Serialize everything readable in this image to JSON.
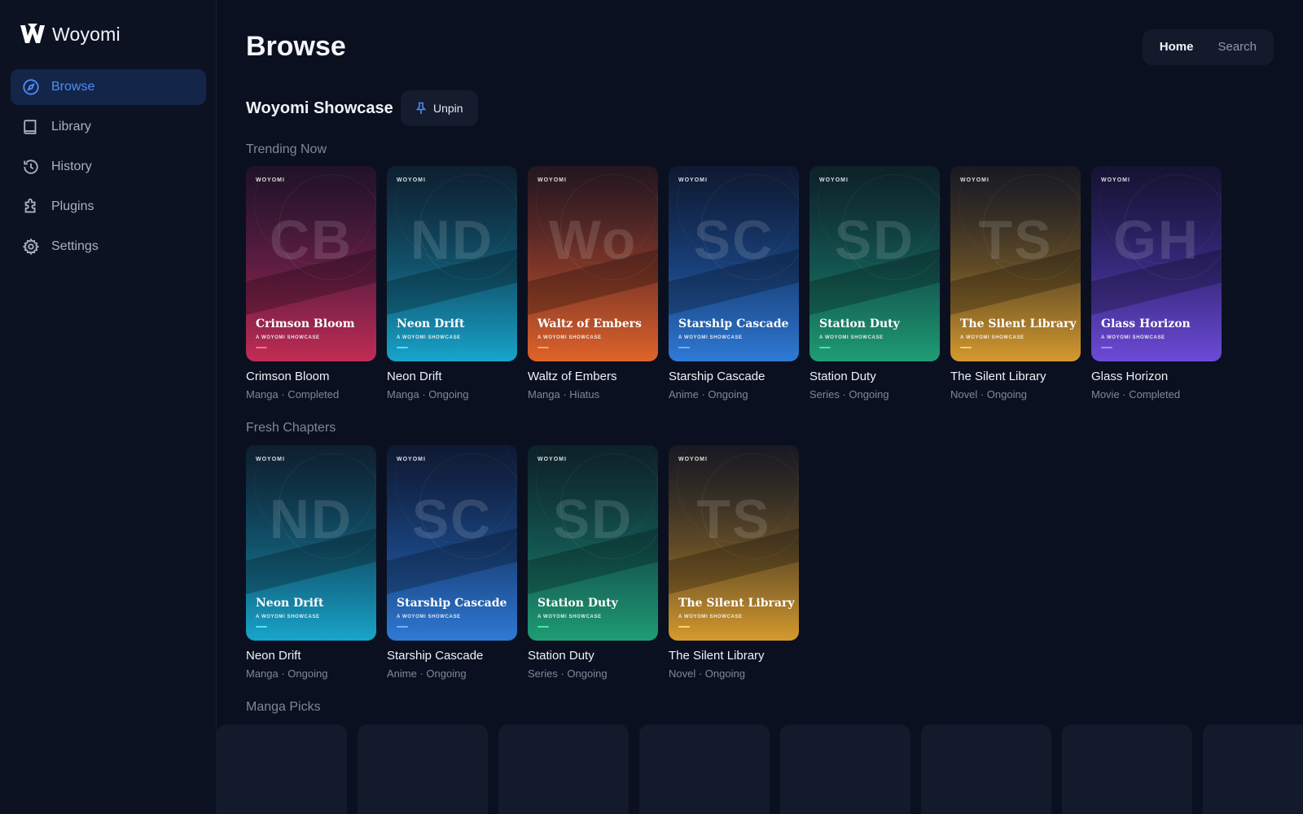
{
  "app": {
    "name": "Woyomi"
  },
  "sidebar": {
    "items": [
      {
        "label": "Browse",
        "icon": "compass-icon",
        "active": true
      },
      {
        "label": "Library",
        "icon": "book-icon"
      },
      {
        "label": "History",
        "icon": "history-icon"
      },
      {
        "label": "Plugins",
        "icon": "puzzle-icon"
      },
      {
        "label": "Settings",
        "icon": "gear-icon"
      }
    ]
  },
  "header": {
    "title": "Browse",
    "tabs": [
      {
        "label": "Home",
        "active": true
      },
      {
        "label": "Search"
      }
    ]
  },
  "showcase": {
    "title": "Woyomi Showcase",
    "unpin_label": "Unpin"
  },
  "cover_brand": "WOYOMI",
  "cover_subtitle": "A WOYOMI SHOWCASE",
  "sections": [
    {
      "label": "Trending Now",
      "items": [
        {
          "title": "Crimson Bloom",
          "meta": "Manga · Completed",
          "mono": "CB",
          "theme": "crimson",
          "accent": "#ff6f91"
        },
        {
          "title": "Neon Drift",
          "meta": "Manga · Ongoing",
          "mono": "ND",
          "theme": "neon",
          "accent": "#55e0ff"
        },
        {
          "title": "Waltz of Embers",
          "meta": "Manga · Hiatus",
          "mono": "Wo",
          "theme": "ember",
          "accent": "#ffa45c"
        },
        {
          "title": "Starship Cascade",
          "meta": "Anime · Ongoing",
          "mono": "SC",
          "theme": "star",
          "accent": "#6fb1ff"
        },
        {
          "title": "Station Duty",
          "meta": "Series · Ongoing",
          "mono": "SD",
          "theme": "station",
          "accent": "#4fe3a8"
        },
        {
          "title": "The Silent Library",
          "meta": "Novel · Ongoing",
          "mono": "TS",
          "theme": "silent",
          "accent": "#ffd06a"
        },
        {
          "title": "Glass Horizon",
          "meta": "Movie · Completed",
          "mono": "GH",
          "theme": "glass",
          "accent": "#a98bff"
        }
      ]
    },
    {
      "label": "Fresh Chapters",
      "items": [
        {
          "title": "Neon Drift",
          "meta": "Manga · Ongoing",
          "mono": "ND",
          "theme": "neon",
          "accent": "#55e0ff"
        },
        {
          "title": "Starship Cascade",
          "meta": "Anime · Ongoing",
          "mono": "SC",
          "theme": "star",
          "accent": "#6fb1ff"
        },
        {
          "title": "Station Duty",
          "meta": "Series · Ongoing",
          "mono": "SD",
          "theme": "station",
          "accent": "#4fe3a8"
        },
        {
          "title": "The Silent Library",
          "meta": "Novel · Ongoing",
          "mono": "TS",
          "theme": "silent",
          "accent": "#ffd06a"
        }
      ]
    },
    {
      "label": "Manga Picks",
      "items": []
    }
  ],
  "colors": {
    "accent": "#4d8df6",
    "background": "#0b1020",
    "sidebar": "#0d1222"
  }
}
